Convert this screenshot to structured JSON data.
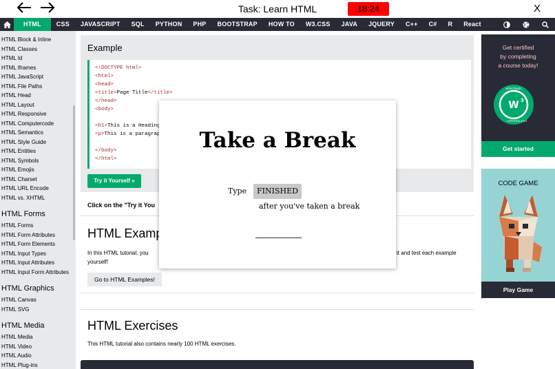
{
  "taskbar": {
    "title": "Task: Learn HTML",
    "timer": "18:24",
    "close": "X",
    "timer_color": "#ff0000"
  },
  "topnav": {
    "items": [
      "HTML",
      "CSS",
      "JAVASCRIPT",
      "SQL",
      "PYTHON",
      "PHP",
      "BOOTSTRAP",
      "HOW TO",
      "W3.CSS",
      "JAVA",
      "JQUERY",
      "C++",
      "C#",
      "R",
      "React"
    ],
    "active": "HTML",
    "bg_color": "#282a35",
    "accent_color": "#04aa6d"
  },
  "sidebar": {
    "group1": [
      "HTML Block & Inline",
      "HTML Classes",
      "HTML Id",
      "HTML Iframes",
      "HTML JavaScript",
      "HTML File Paths",
      "HTML Head",
      "HTML Layout",
      "HTML Responsive",
      "HTML Computercode",
      "HTML Semantics",
      "HTML Style Guide",
      "HTML Entities",
      "HTML Symbols",
      "HTML Emojis",
      "HTML Charset",
      "HTML URL Encode",
      "HTML vs. XHTML"
    ],
    "forms_heading": "HTML Forms",
    "forms": [
      "HTML Forms",
      "HTML Form Attributes",
      "HTML Form Elements",
      "HTML Input Types",
      "HTML Input Attributes",
      "HTML Input Form Attributes"
    ],
    "graphics_heading": "HTML Graphics",
    "graphics": [
      "HTML Canvas",
      "HTML SVG"
    ],
    "media_heading": "HTML Media",
    "media": [
      "HTML Media",
      "HTML Video",
      "HTML Audio",
      "HTML Plug-ins"
    ]
  },
  "main": {
    "example_title": "Example",
    "code": [
      {
        "tag": "<!DOCTYPE html>",
        "text": "",
        "close": ""
      },
      {
        "tag": "<html>",
        "text": "",
        "close": ""
      },
      {
        "tag": "<head>",
        "text": "",
        "close": ""
      },
      {
        "tag": "<title>",
        "text": "Page Title",
        "close": "</title>"
      },
      {
        "tag": "</head>",
        "text": "",
        "close": ""
      },
      {
        "tag": "<body>",
        "text": "",
        "close": ""
      },
      {
        "tag": "",
        "text": "",
        "close": ""
      },
      {
        "tag": "<h1>",
        "text": "This is a Heading",
        "close": ""
      },
      {
        "tag": "<p>",
        "text": "This is a paragraph",
        "close": ""
      },
      {
        "tag": "",
        "text": "",
        "close": ""
      },
      {
        "tag": "</body>",
        "text": "",
        "close": ""
      },
      {
        "tag": "</html>",
        "text": "",
        "close": ""
      }
    ],
    "try_button": "Try it Yourself »",
    "click_note": "Click on the \"Try it You",
    "examples_title": "HTML Exampl",
    "examples_text_left": "In this HTML tutorial, you",
    "examples_text_right": "it and test each example",
    "examples_text_line2": "yourself!",
    "examples_button": "Go to HTML Examples!",
    "exercises_title": "HTML Exercises",
    "exercises_text": "This HTML tutorial also contains nearly 100 HTML exercises."
  },
  "ads": {
    "cert_lines": [
      "Get certified",
      "by completing",
      "a course today!"
    ],
    "cert_button": "Get started",
    "badge_brand": "w3schools",
    "badge_word": "CERTIFIED",
    "badge_year": "2021",
    "game_title": "CODE GAME",
    "game_button": "Play Game"
  },
  "modal": {
    "title": "Take a Break",
    "type_label": "Type",
    "finished_chip": "FINISHED",
    "after_text": "after you've taken a break",
    "input_value": ""
  }
}
